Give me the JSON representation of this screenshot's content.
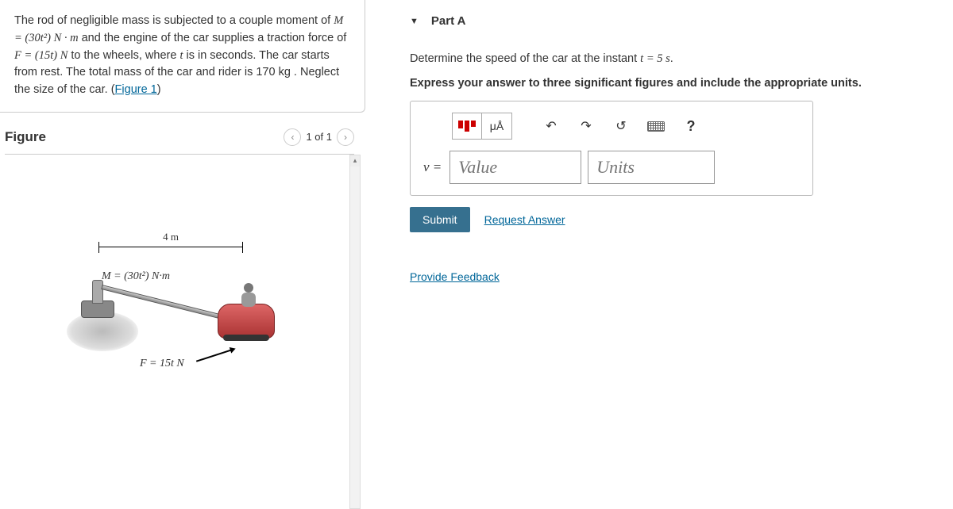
{
  "problem": {
    "text_pre": "The rod of negligible mass is subjected to a couple moment of ",
    "M_expr": "M = (30t²) N · m",
    "text_mid1": " and the engine of the car supplies a traction force of ",
    "F_expr": "F = (15t) N",
    "text_mid2": " to the wheels, where ",
    "t_var": "t",
    "text_mid3": " is in seconds. The car starts from rest. The total mass of the car and rider is 170  kg . Neglect the size of the car. (",
    "figure_link": "Figure 1",
    "text_end": ")"
  },
  "figure": {
    "title": "Figure",
    "counter": "1 of 1",
    "dim_label": "4 m",
    "M_label": "M = (30t²) N·m",
    "F_label": "F = 15t N"
  },
  "partA": {
    "title": "Part A",
    "prompt_line1_pre": "Determine the speed of the car at the instant ",
    "prompt_line1_expr": "t = 5 s",
    "prompt_line1_post": ".",
    "prompt_line2": "Express your answer to three significant figures and include the appropriate units.",
    "toolbar": {
      "units_symbol": "μÅ",
      "help": "?"
    },
    "var": "v =",
    "value_placeholder": "Value",
    "units_placeholder": "Units",
    "submit": "Submit",
    "request": "Request Answer"
  },
  "feedback_link": "Provide Feedback"
}
